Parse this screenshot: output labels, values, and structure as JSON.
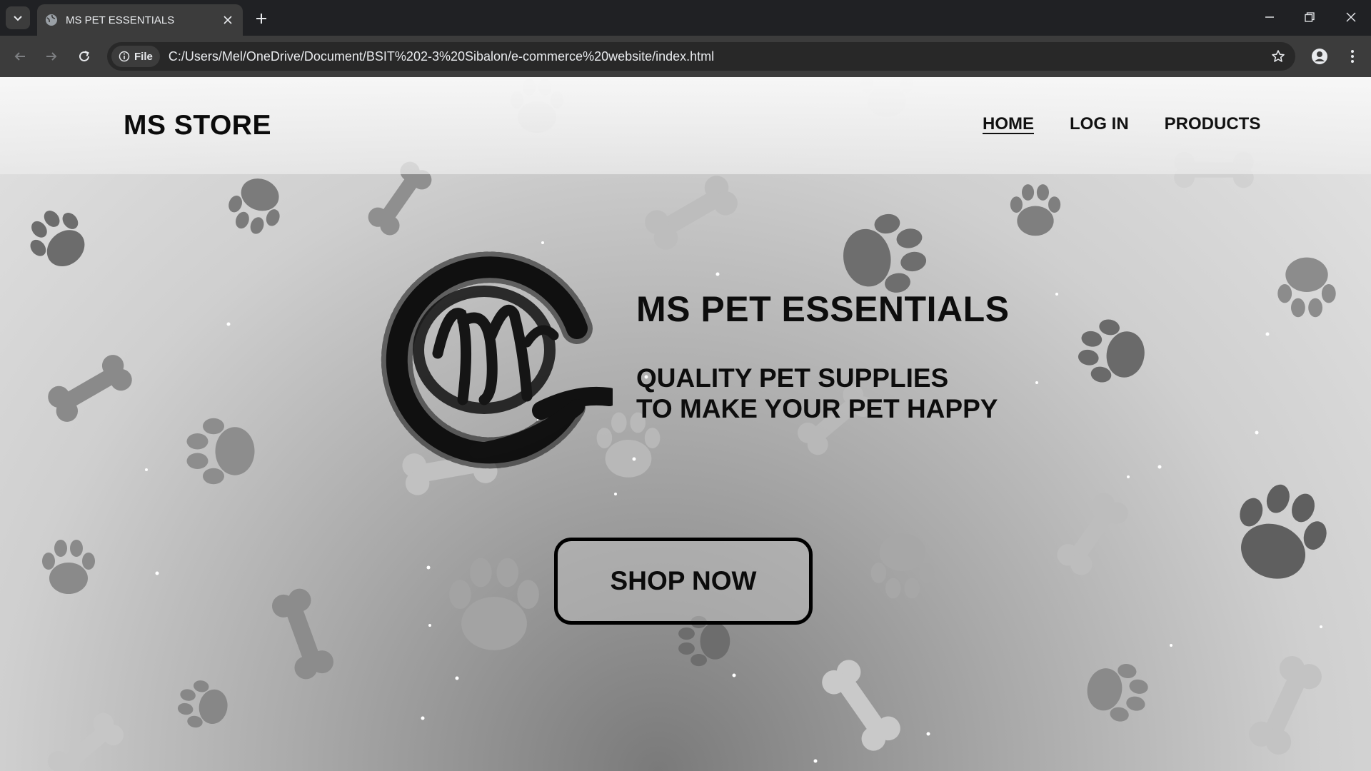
{
  "browser": {
    "tab_title": "MS PET ESSENTIALS",
    "scheme_chip": "File",
    "url": "C:/Users/Mel/OneDrive/Document/BSIT%202-3%20Sibalon/e-commerce%20website/index.html"
  },
  "site": {
    "brand": "MS STORE",
    "nav": [
      {
        "label": "HOME",
        "active": true
      },
      {
        "label": "LOG IN",
        "active": false
      },
      {
        "label": "PRODUCTS",
        "active": false
      }
    ],
    "hero": {
      "title": "MS PET ESSENTIALS",
      "subtitle_line1": "QUALITY PET SUPPLIES",
      "subtitle_line2": "TO MAKE YOUR PET HAPPY",
      "cta": "SHOP NOW"
    },
    "logo_text": "MS"
  },
  "colors": {
    "chrome_dark": "#202124",
    "chrome_toolbar": "#3c3c3c",
    "page_text": "#0d0d0d",
    "paw_dark": "#6e6e6e",
    "paw_light": "#b5b5b5"
  }
}
